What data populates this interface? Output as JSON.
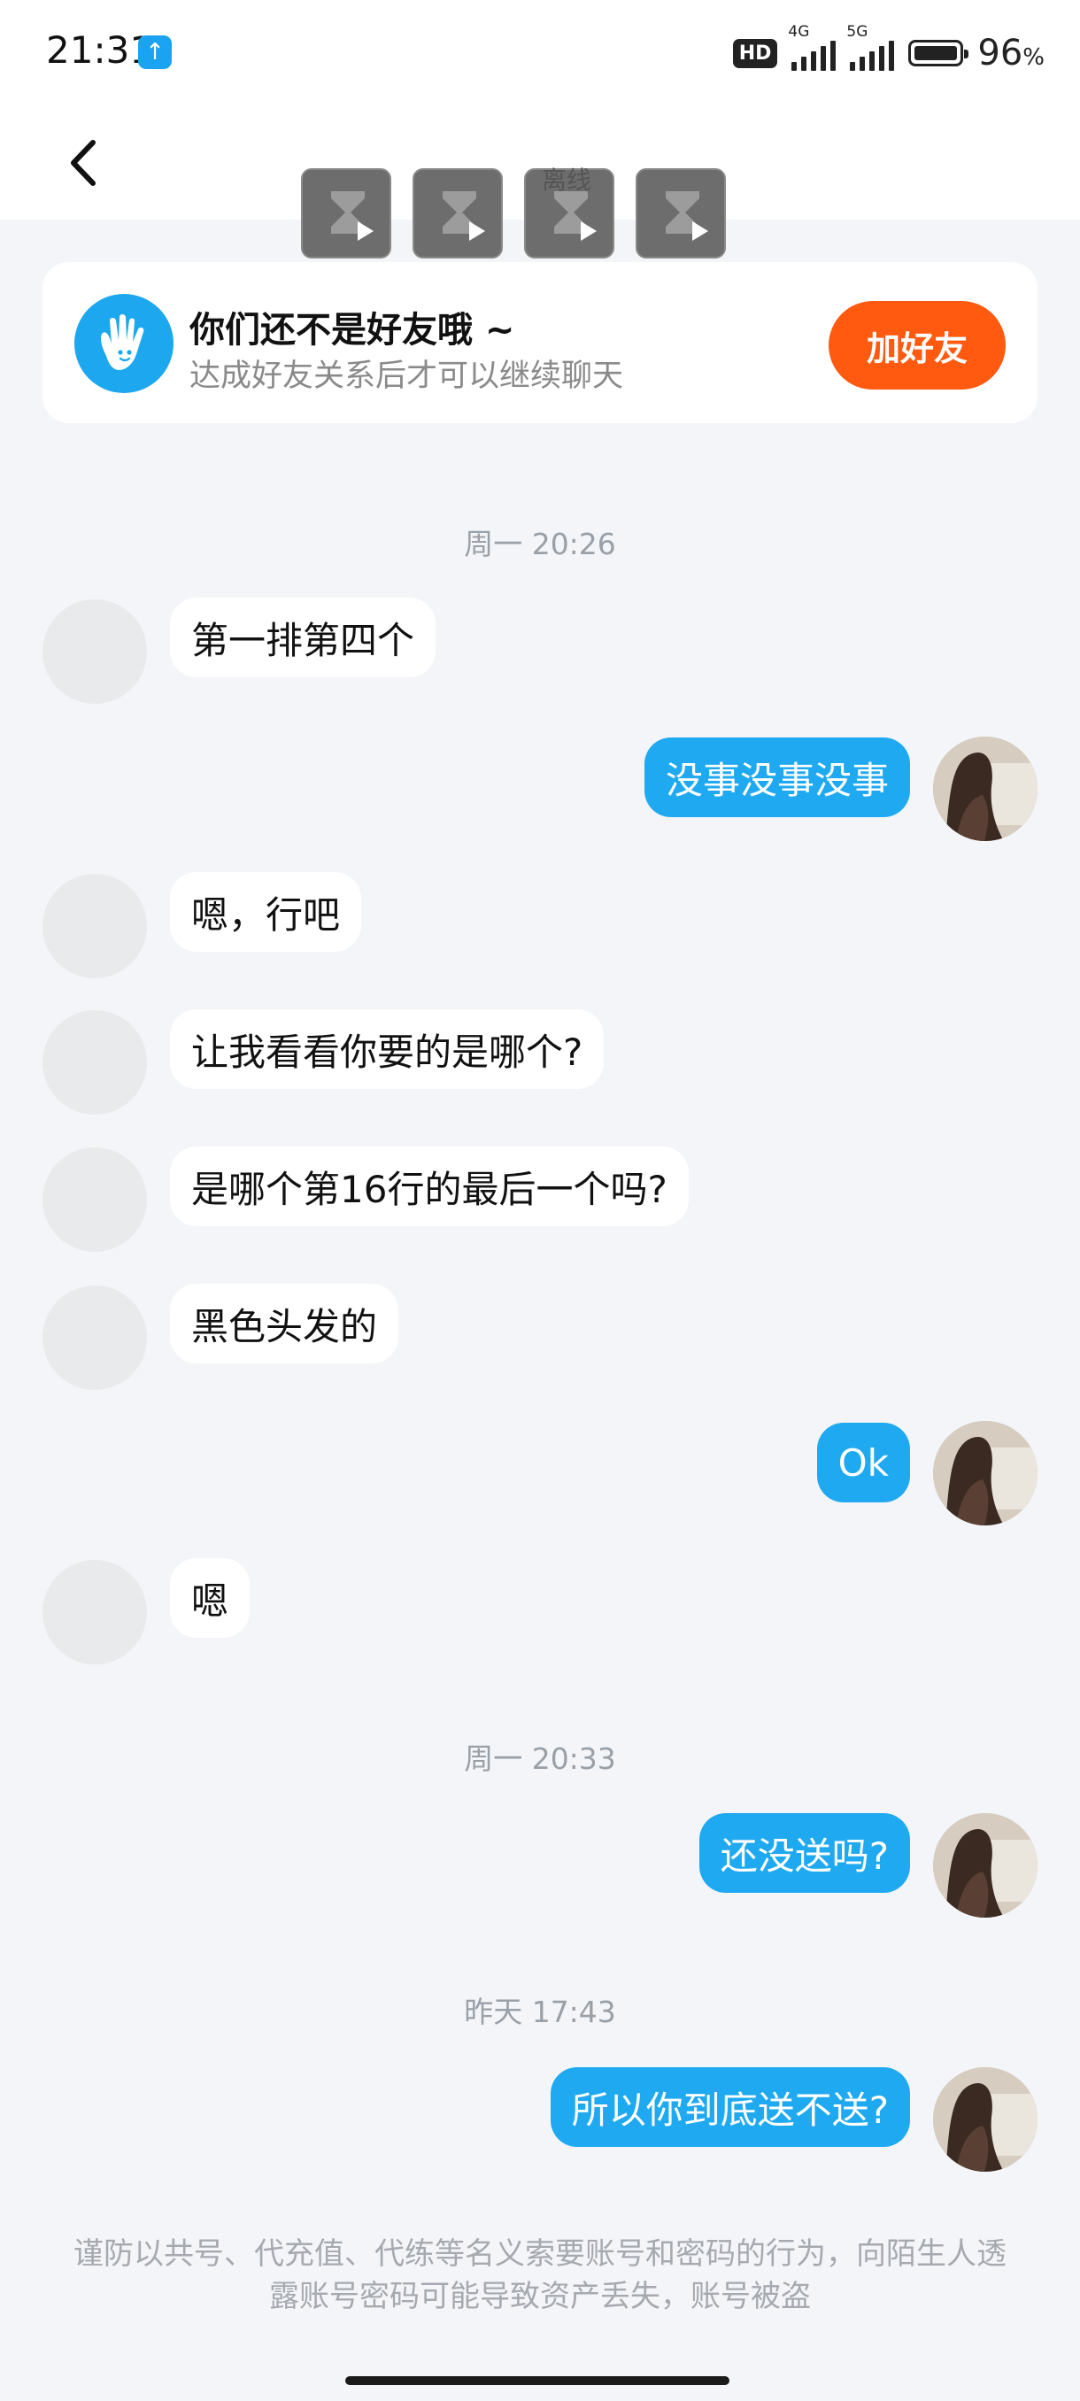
{
  "status_bar": {
    "time": "21:31",
    "hd_label": "HD",
    "net1_label": "4G",
    "net2_label": "5G",
    "battery_percent": "96",
    "battery_unit": "%"
  },
  "header": {
    "offline_label": "离线"
  },
  "friend_notice": {
    "title": "你们还不是好友哦 ~",
    "subtitle": "达成好友关系后才可以继续聊天",
    "button_label": "加好友"
  },
  "timestamps": {
    "t1": "周一 20:26",
    "t2": "周一 20:33",
    "t3": "昨天 17:43"
  },
  "messages": [
    {
      "dir": "in",
      "text": "第一排第四个"
    },
    {
      "dir": "out",
      "text": "没事没事没事"
    },
    {
      "dir": "in",
      "text": "嗯，行吧"
    },
    {
      "dir": "in",
      "text": "让我看看你要的是哪个?"
    },
    {
      "dir": "in",
      "text": "是哪个第16行的最后一个吗?"
    },
    {
      "dir": "in",
      "text": "黑色头发的"
    },
    {
      "dir": "out",
      "text": "Ok"
    },
    {
      "dir": "in",
      "text": "嗯"
    },
    {
      "dir": "out",
      "text": "还没送吗?"
    },
    {
      "dir": "out",
      "text": "所以你到底送不送?"
    }
  ],
  "footer": {
    "warning": "谨防以共号、代充值、代练等名义索要账号和密码的行为，向陌生人透露账号密码可能导致资产丢失，账号被盗"
  },
  "colors": {
    "accent_blue": "#1ea9f0",
    "button_orange": "#ff5a10",
    "background": "#f3f5f8"
  }
}
